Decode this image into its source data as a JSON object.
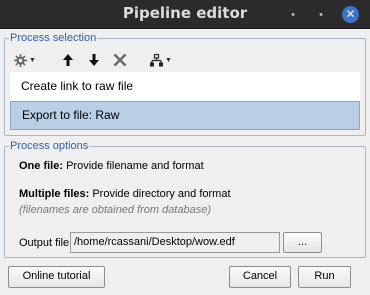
{
  "window": {
    "title": "Pipeline editor"
  },
  "process_selection": {
    "legend": "Process selection",
    "toolbar": [
      {
        "icon": "gear-icon",
        "has_dropdown": true
      },
      {
        "icon": "arrow-up-icon"
      },
      {
        "icon": "arrow-down-icon"
      },
      {
        "icon": "delete-x-icon"
      },
      {
        "icon": "pipeline-tree-icon",
        "has_dropdown": true
      }
    ],
    "items": [
      {
        "label": "Create link to raw file",
        "selected": false
      },
      {
        "label": "Export to file: Raw",
        "selected": true
      }
    ]
  },
  "process_options": {
    "legend": "Process options",
    "one_file_label": "One file:",
    "one_file_text": " Provide filename and format",
    "multiple_files_label": "Multiple files:",
    "multiple_files_text": " Provide directory and format",
    "note": "(filenames are obtained from database)",
    "output_label": "Output file",
    "output_value": "/home/rcassani/Desktop/wow.edf",
    "browse_label": "..."
  },
  "buttons": {
    "tutorial": "Online tutorial",
    "cancel": "Cancel",
    "run": "Run"
  },
  "colors": {
    "titlebar": "#2b2b2b",
    "accent_legend": "#2e5fa8",
    "selection": "#b8cfe5",
    "close_button": "#3b73c9"
  }
}
